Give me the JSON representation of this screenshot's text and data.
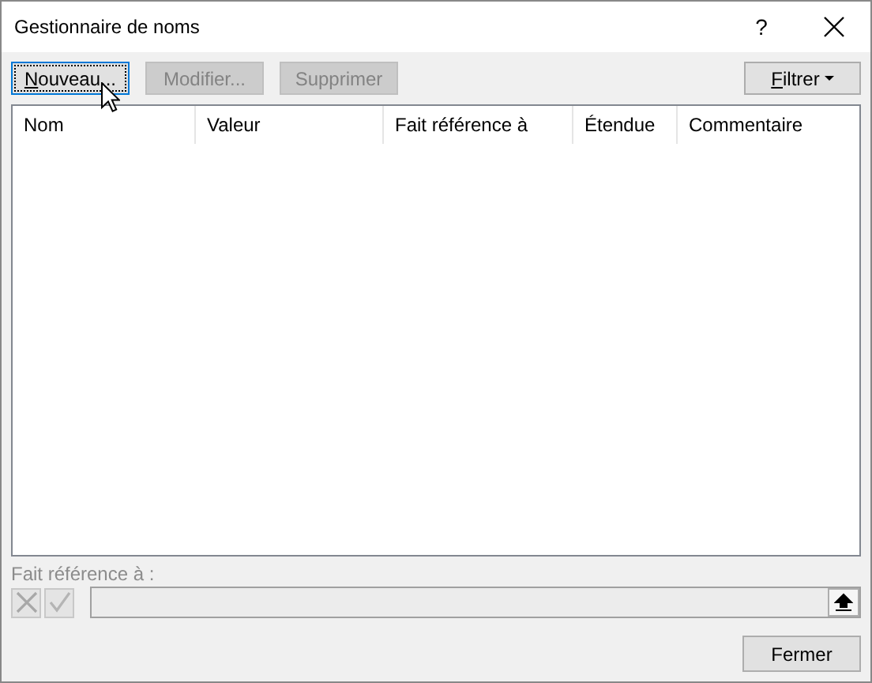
{
  "window": {
    "title": "Gestionnaire de noms",
    "help": "?"
  },
  "toolbar": {
    "buttons": [
      {
        "label": "Nouveau...",
        "disabled": false,
        "focused": true,
        "underline_first": true
      },
      {
        "label": "Modifier...",
        "disabled": true,
        "focused": false,
        "underline_first": false
      },
      {
        "label": "Supprimer",
        "disabled": true,
        "focused": false,
        "underline_first": false
      }
    ],
    "filter": {
      "label": "Filtrer",
      "underline_first": true
    }
  },
  "table": {
    "columns": [
      "Nom",
      "Valeur",
      "Fait référence à",
      "Étendue",
      "Commentaire"
    ]
  },
  "reference": {
    "label": "Fait référence à :",
    "disabled": true
  },
  "buttons": [
    "Fermer"
  ]
}
